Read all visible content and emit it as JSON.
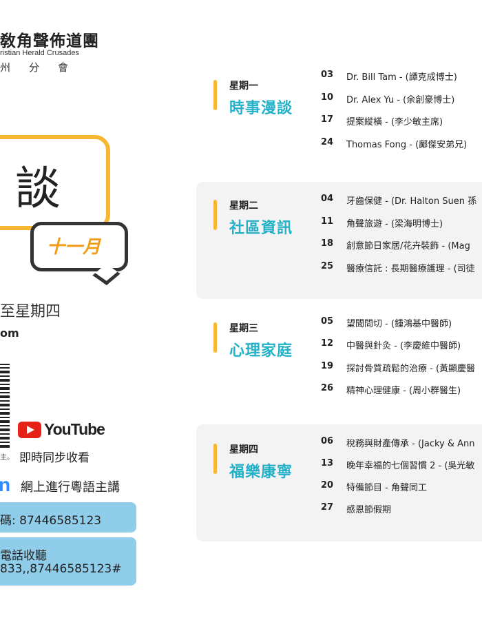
{
  "org": {
    "name": "敎角聲佈道團",
    "en": "ristian Herald Crusades",
    "branch": "州分會"
  },
  "promo": {
    "bubble_char": "談",
    "month": "十一月",
    "days": "至星期四",
    "email_tail": "om",
    "qr_caption": "主。",
    "youtube_word": "YouTube",
    "youtube_sub": "即時同步收看",
    "zoom_letter": "n",
    "zoom_text": "網上進行粵語主講",
    "meeting_id": "碼: 87446585123",
    "phone_line1": "電話收聽",
    "phone_line2": "833,,87446585123#"
  },
  "colors": {
    "accent_yellow": "#f7b733",
    "title_teal": "#23b1c8",
    "box_blue": "#8fcdea",
    "youtube_red": "#e62117",
    "zoom_blue": "#2d8cff"
  },
  "schedule": [
    {
      "day": "星期一",
      "title": "時事漫談",
      "rows": [
        {
          "date": "03",
          "text": "Dr. Bill Tam - (譚克成博士)"
        },
        {
          "date": "10",
          "text": "Dr. Alex Yu - (余創豪博士)"
        },
        {
          "date": "17",
          "text": "提案縱橫 - (李少敏主席)"
        },
        {
          "date": "24",
          "text": "Thomas Fong - (鄺傑安弟兄)"
        }
      ]
    },
    {
      "day": "星期二",
      "title": "社區資訊",
      "rows": [
        {
          "date": "04",
          "text": "牙齒保健 - (Dr. Halton Suen 孫"
        },
        {
          "date": "11",
          "text": "角聲旅遊 - (梁海明博士)"
        },
        {
          "date": "18",
          "text": "創意節日家居/花卉裝飾 - (Mag"
        },
        {
          "date": "25",
          "text": "醫療信託 : 長期醫療護理 - (司徒"
        }
      ]
    },
    {
      "day": "星期三",
      "title": "心理家庭",
      "rows": [
        {
          "date": "05",
          "text": "望聞問切 - (鍾鴻基中醫師)"
        },
        {
          "date": "12",
          "text": "中醫與針灸 - (李慶維中醫師)"
        },
        {
          "date": "19",
          "text": "探討骨質疏鬆的治療 - (黃顯慶醫"
        },
        {
          "date": "26",
          "text": "精神心理健康 - (周小群醫生)"
        }
      ]
    },
    {
      "day": "星期四",
      "title": "福樂康寧",
      "rows": [
        {
          "date": "06",
          "text": "稅務與財產傳承  - (Jacky & Ann"
        },
        {
          "date": "13",
          "text": "晚年幸福的七個習慣 2 - (吳光敏"
        },
        {
          "date": "20",
          "text": "特備節目 - 角聲同工"
        },
        {
          "date": "27",
          "text": "感恩節假期"
        }
      ]
    }
  ]
}
